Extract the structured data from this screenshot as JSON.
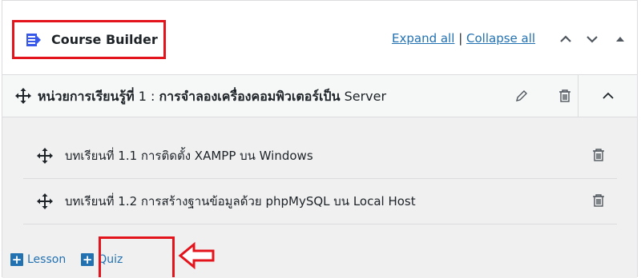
{
  "header": {
    "title": "Course Builder",
    "expand_all": "Expand all",
    "separator": "|",
    "collapse_all": "Collapse all"
  },
  "section": {
    "title_bold": "หน่วยการเรียนรู้ที่",
    "title_rest": " 1 : ",
    "title_bold2": "การจำลองเครื่องคอมพิวเตอร์เป็น",
    "title_end": " Server"
  },
  "lessons": [
    {
      "title": "บทเรียนที่ 1.1 การติดตั้ง XAMPP บน Windows"
    },
    {
      "title": "บทเรียนที่ 1.2 การสร้างฐานข้อมูลด้วย phpMySQL บน Local Host"
    }
  ],
  "actions": {
    "add_lesson": "Lesson",
    "add_quiz": "Quiz"
  },
  "colors": {
    "accent": "#2271b1",
    "highlight": "#e3141b",
    "icon_blue": "#3858e9"
  }
}
